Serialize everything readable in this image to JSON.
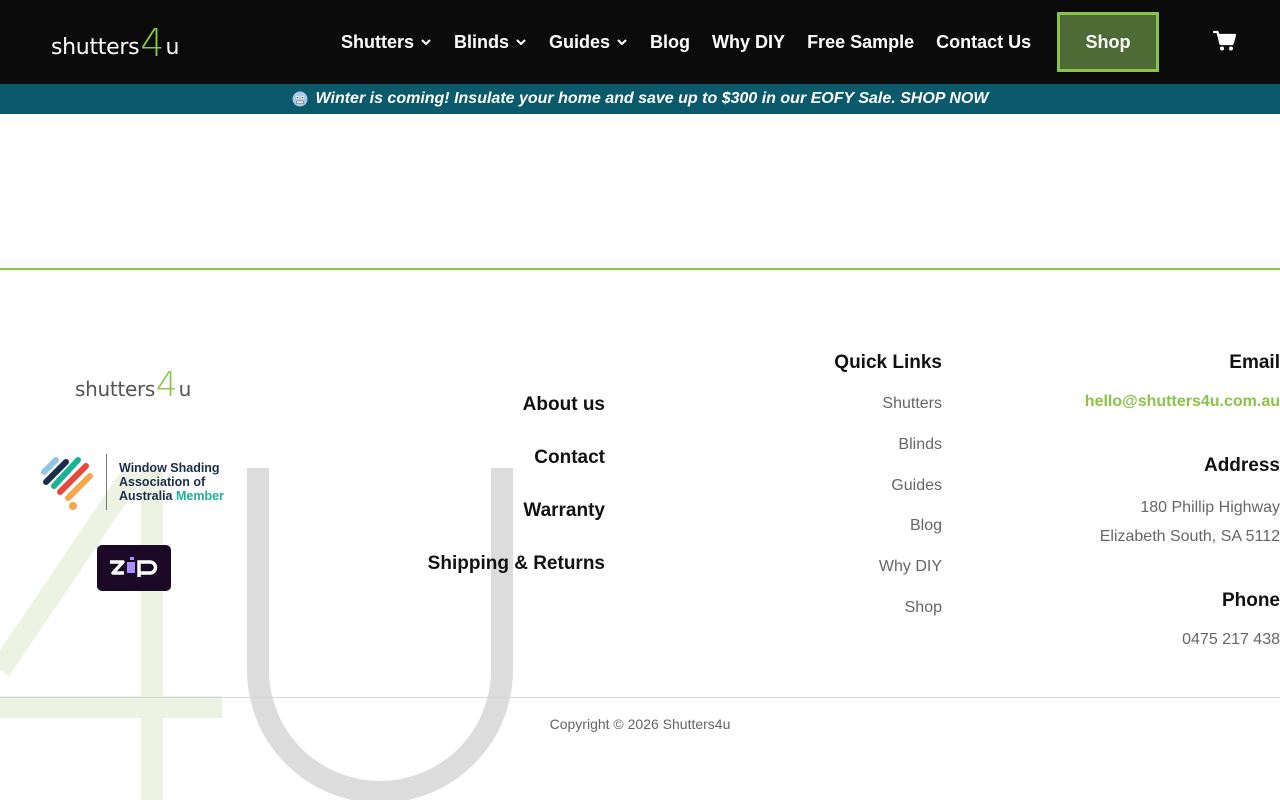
{
  "header": {
    "logo": {
      "word": "shutters",
      "four": "4",
      "suffix": "u"
    },
    "nav": [
      {
        "label": "Shutters",
        "dropdown": true
      },
      {
        "label": "Blinds",
        "dropdown": true
      },
      {
        "label": "Guides",
        "dropdown": true
      },
      {
        "label": "Blog",
        "dropdown": false
      },
      {
        "label": "Why DIY",
        "dropdown": false
      },
      {
        "label": "Free Sample",
        "dropdown": false
      },
      {
        "label": "Contact Us",
        "dropdown": false
      }
    ],
    "shop_label": "Shop",
    "cart_icon": "cart-icon"
  },
  "promo": {
    "text": "Winter is coming! Insulate your home and save up to $300 in our EOFY Sale. SHOP NOW",
    "icon": "cold-face-emoji"
  },
  "footer": {
    "logo": {
      "word": "shutters",
      "four": "4",
      "suffix": "u"
    },
    "watermark": "4U",
    "wsa": {
      "line1": "Window Shading",
      "line2": "Association of",
      "line3": "Australia",
      "member": "Member"
    },
    "zip_label": "ZIP",
    "links": [
      "About us",
      "Contact",
      "Warranty",
      "Shipping & Returns"
    ],
    "quick_links": {
      "title": "Quick Links",
      "items": [
        "Shutters",
        "Blinds",
        "Guides",
        "Blog",
        "Why DIY",
        "Shop"
      ]
    },
    "contact": {
      "email_title": "Email",
      "email": "hello@shutters4u.com.au",
      "address_title": "Address",
      "address_line1": "180 Phillip Highway",
      "address_line2": "Elizabeth South, SA 5112",
      "phone_title": "Phone",
      "phone": "0475 217 438"
    },
    "copyright": "Copyright © 2026 Shutters4u"
  },
  "colors": {
    "header_bg": "#0b0b0b",
    "accent_green": "#8bc34a",
    "shop_bg": "#4e6b35",
    "promo_bg": "#0a5a6b"
  }
}
